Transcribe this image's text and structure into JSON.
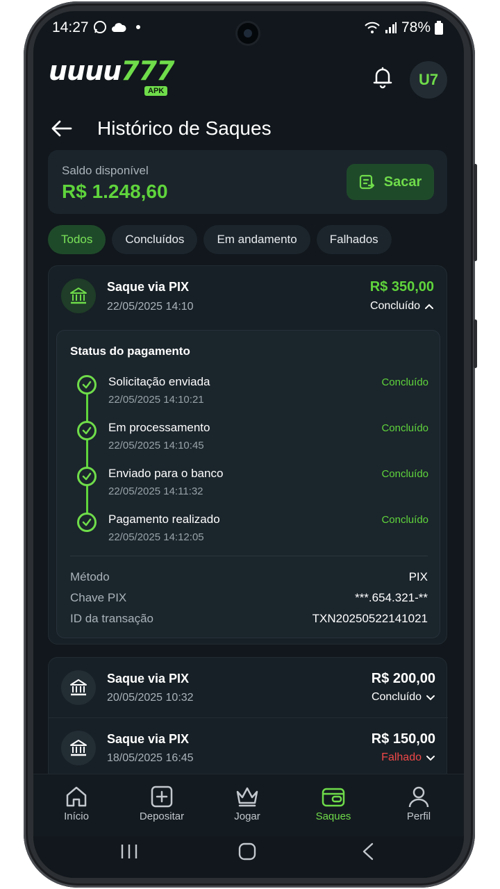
{
  "status_bar": {
    "time": "14:27",
    "battery": "78%"
  },
  "header": {
    "logo_text": "uuuu",
    "logo_number": "777",
    "logo_badge": "APK",
    "avatar_initials": "U7"
  },
  "page": {
    "title": "Histórico de Saques"
  },
  "balance": {
    "label": "Saldo disponível",
    "value": "R$ 1.248,60",
    "button_label": "Sacar"
  },
  "tabs": [
    {
      "label": "Todos",
      "active": true
    },
    {
      "label": "Concluídos",
      "active": false
    },
    {
      "label": "Em andamento",
      "active": false
    },
    {
      "label": "Falhados",
      "active": false
    }
  ],
  "withdrawals": [
    {
      "title": "Saque via PIX",
      "date": "22/05/2025 14:10",
      "amount": "R$ 350,00",
      "status": "Concluído",
      "status_box": {
        "title": "Status do pagamento",
        "steps": [
          {
            "label": "Solicitação enviada",
            "date": "22/05/2025 14:10:21",
            "status": "Concluído"
          },
          {
            "label": "Em processamento",
            "date": "22/05/2025 14:10:45",
            "status": "Concluído"
          },
          {
            "label": "Enviado para o banco",
            "date": "22/05/2025 14:11:32",
            "status": "Concluído"
          },
          {
            "label": "Pagamento realizado",
            "date": "22/05/2025 14:12:05",
            "status": "Concluído"
          }
        ],
        "details": [
          {
            "key": "Método",
            "value": "PIX"
          },
          {
            "key": "Chave PIX",
            "value": "***.654.321-**"
          },
          {
            "key": "ID da transação",
            "value": "TXN20250522141021"
          }
        ]
      }
    },
    {
      "title": "Saque via PIX",
      "date": "20/05/2025 10:32",
      "amount": "R$ 200,00",
      "status": "Concluído"
    },
    {
      "title": "Saque via PIX",
      "date": "18/05/2025 16:45",
      "amount": "R$ 150,00",
      "status": "Falhado"
    }
  ],
  "bottom_nav": [
    {
      "label": "Início",
      "icon": "home-icon"
    },
    {
      "label": "Depositar",
      "icon": "plus-square-icon"
    },
    {
      "label": "Jogar",
      "icon": "crown-icon"
    },
    {
      "label": "Saques",
      "icon": "wallet-icon",
      "active": true
    },
    {
      "label": "Perfil",
      "icon": "user-icon"
    }
  ],
  "colors": {
    "accent": "#6fdc4a",
    "success": "#5fd43c",
    "error": "#f04848",
    "background": "#11171c",
    "card": "#172026"
  }
}
